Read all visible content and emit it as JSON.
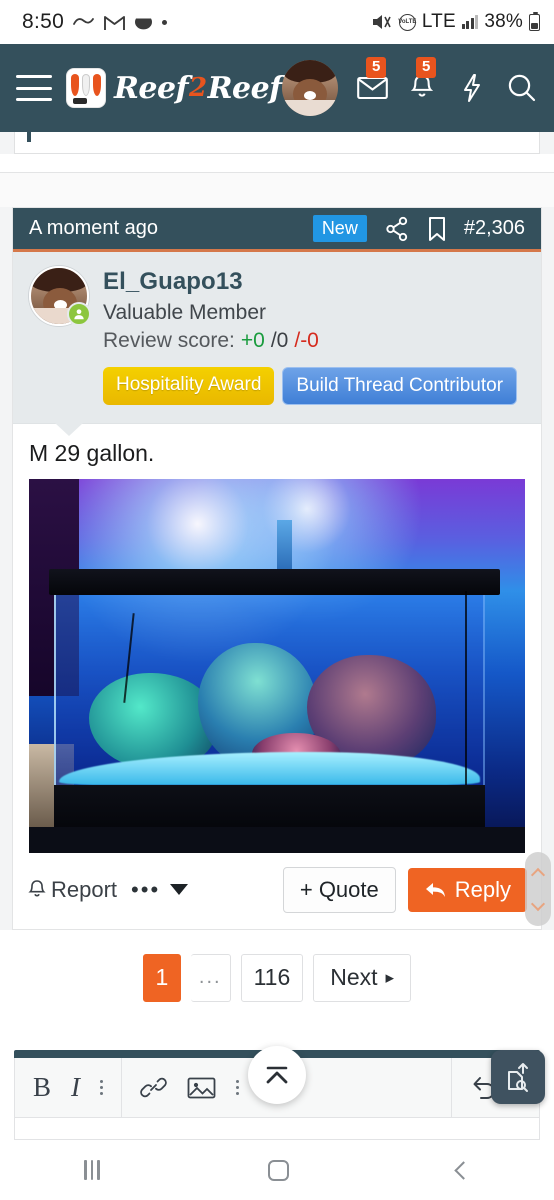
{
  "status_bar": {
    "time": "8:50",
    "battery_percent": "38%",
    "network": "LTE",
    "icons": [
      "wave-icon",
      "gmail-icon",
      "hangouts-icon",
      "dot-icon",
      "mute-icon",
      "volte-icon",
      "signal-bars-icon",
      "battery-icon"
    ],
    "volte_label": "VoLTE"
  },
  "app_header": {
    "menu_icon": "hamburger-menu-icon",
    "brand_name_part1": "Reef",
    "brand_name_part2": "2",
    "brand_name_part3": "Reef",
    "avatar": "user-avatar",
    "inbox_badge": "5",
    "alerts_badge": "5",
    "icons": [
      "envelope-icon",
      "bell-icon",
      "bolt-icon",
      "search-icon"
    ]
  },
  "post": {
    "timestamp": "A moment ago",
    "new_badge": "New",
    "post_number": "#2,306",
    "share_icon": "share-icon",
    "bookmark_icon": "bookmark-icon",
    "author": {
      "username": "El_Guapo13",
      "title": "Valuable Member",
      "review_label": "Review score:",
      "review_positive": "+0",
      "review_neutral": "/0",
      "review_negative": "/-0",
      "online_status": "online",
      "awards": [
        {
          "label": "Hospitality Award",
          "color": "#e9b800"
        },
        {
          "label": "Build Thread Contributor",
          "color": "#3f7fd6"
        }
      ]
    },
    "message": "M 29 gallon.",
    "attachment_alt": "reef-aquarium-photo",
    "actions": {
      "report_label": "Report",
      "report_icon": "bell-icon",
      "more_icon": "ellipsis-icon",
      "dropdown_icon": "caret-down-icon",
      "quote_label": "+ Quote",
      "reply_label": "Reply",
      "reply_icon": "reply-arrow-icon"
    }
  },
  "pagination": {
    "current": "1",
    "ellipsis": "...",
    "last": "116",
    "next_label": "Next",
    "next_icon": "caret-right-icon"
  },
  "editor": {
    "bold": "B",
    "italic": "I",
    "icons": [
      "bold-icon",
      "italic-icon",
      "vertical-ellipsis-icon",
      "link-icon",
      "image-icon",
      "vertical-ellipsis-icon",
      "undo-icon",
      "vertical-ellipsis-icon"
    ]
  },
  "floating": {
    "scroll_top_icon": "scroll-to-top-icon",
    "upload_icon": "upload-document-icon"
  },
  "nav_bar": {
    "recents_icon": "recents-icon",
    "home_icon": "home-icon",
    "back_icon": "back-icon"
  },
  "colors": {
    "header_bg": "#34505c",
    "accent_orange": "#ef6423",
    "new_badge_blue": "#2196e3",
    "online_green": "#8cc63e"
  }
}
